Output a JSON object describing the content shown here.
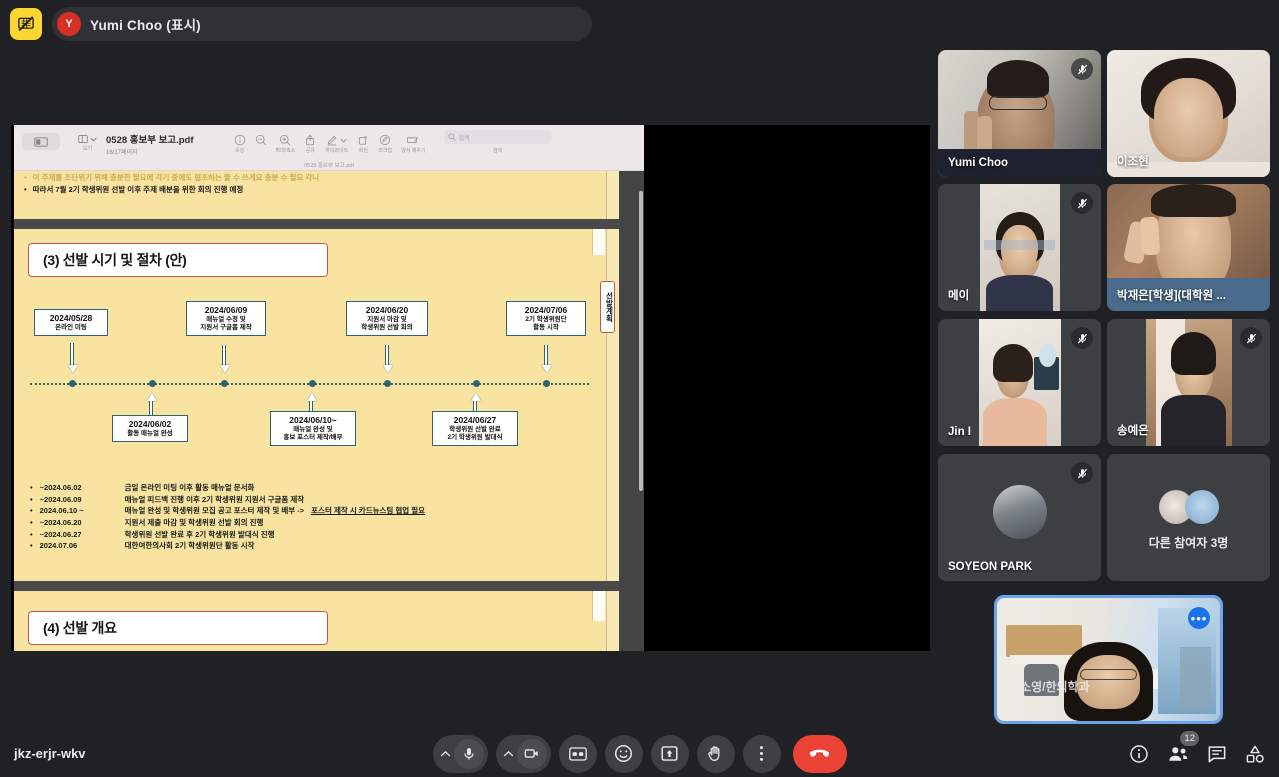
{
  "topbar": {
    "stop_present_icon": "stop-presenting-icon",
    "presenter_initial": "Y",
    "presenter_label": "Yumi Choo (표시)"
  },
  "preview_window": {
    "sidebar_button_icon": "sidebar-toggle-icon",
    "view_label": "보기",
    "doc_name": "0528 홍보부 보고.pdf",
    "doc_pages": "16/17페이지",
    "window_title": "0528 홍보부 보고.pdf",
    "tools": [
      {
        "icon": "info-icon",
        "label": "속성"
      },
      {
        "icon": "zoom-out-icon",
        "label": ""
      },
      {
        "icon": "zoom-in-icon",
        "label": "확대/축소"
      },
      {
        "icon": "share-icon",
        "label": "공유"
      },
      {
        "icon": "highlight-pen-icon",
        "label": "하이라이트"
      },
      {
        "icon": "rotate-icon",
        "label": "회전"
      },
      {
        "icon": "markup-icon",
        "label": "마크업"
      },
      {
        "icon": "form-fill-icon",
        "label": "양식 채우기"
      }
    ],
    "search_placeholder": "검색",
    "search_label": "검색"
  },
  "slide": {
    "prev_bullets": [
      "이 주제를 조단위기 위해 충분한 필요에 각기 중에도 협조하는 줄 수 쓰게요 충분 수 필요 각니",
      "따라서 7월 2기 학생위원 선발 이후 주제 배분을 위한 회의 진행 예정"
    ],
    "section_title": "(3) 선발 시기 및 절차 (안)",
    "next_section_title": "(4) 선발 개요",
    "side_tab": "선발계획",
    "side_tab_partial": "선",
    "timeline_top": [
      {
        "date": "2024/05/28",
        "lines": [
          "온라인 미팅"
        ]
      },
      {
        "date": "2024/06/09",
        "lines": [
          "매뉴얼 수정 및",
          "지원서 구글폼 제작"
        ]
      },
      {
        "date": "2024/06/20",
        "lines": [
          "지원서 마감 및",
          "학생위원 선발 회의"
        ]
      },
      {
        "date": "2024/07/06",
        "lines": [
          "2기 학생위원단",
          "활동 시작"
        ]
      }
    ],
    "timeline_bottom": [
      {
        "date": "2024/06/02",
        "lines": [
          "활동 매뉴얼 완성"
        ]
      },
      {
        "date": "2024/06/10~",
        "lines": [
          "매뉴얼 완성 및",
          "홍보 포스터 제작/배부"
        ]
      },
      {
        "date": "2024/06/27",
        "lines": [
          "학생위원 선발 완료",
          "2기 학생위원 발대식"
        ]
      }
    ],
    "bullets": [
      {
        "date": "~2024.06.02",
        "text": "금일 온라인 미팅 이후 활동 매뉴얼 문서화",
        "underline": ""
      },
      {
        "date": "~2024.06.09",
        "text": "매뉴얼 피드백 진행 이후 2기 학생위원 지원서 구글폼 제작",
        "underline": ""
      },
      {
        "date": "2024.06.10 ~",
        "text": "매뉴얼 완성 및 학생위원 모집 공고 포스터 제작 및 배부 -> ",
        "underline": "포스터 제작 시 카드뉴스팀 협업 필요"
      },
      {
        "date": "~2024.06.20",
        "text": "지원서 제출 마감 및 학생위원 선발 회의 진행",
        "underline": ""
      },
      {
        "date": "~2024.06.27",
        "text": "학생위원 선발 완료 후 2기 학생위원 발대식 진행",
        "underline": ""
      },
      {
        "date": "2024.07.06",
        "text": "대한여한의사회 2기 학생위원단 활동 시작",
        "underline": ""
      }
    ]
  },
  "participants": [
    {
      "name": "Yumi Choo",
      "muted": true,
      "kind": "video-wide"
    },
    {
      "name": "이조현",
      "muted": false,
      "kind": "video-wide"
    },
    {
      "name": "메이",
      "muted": true,
      "kind": "video-portrait"
    },
    {
      "name": "박재은[학생](대학원 ...",
      "muted": false,
      "kind": "video-wide"
    },
    {
      "name": "Jin I",
      "muted": true,
      "kind": "video-portrait"
    },
    {
      "name": "송예은",
      "muted": true,
      "kind": "video-portrait"
    },
    {
      "name": "SOYEON PARK",
      "muted": true,
      "kind": "avatar"
    },
    {
      "name": "다른 참여자 3명",
      "muted": false,
      "kind": "others"
    }
  ],
  "selfview": {
    "name": "인소영/한의학과",
    "more_icon": "more-options-icon"
  },
  "bottombar": {
    "meeting_code": "jkz-erjr-wkv",
    "controls": [
      {
        "name": "microphone-button",
        "icon": "mic-icon"
      },
      {
        "name": "camera-button",
        "icon": "video-camera-icon"
      },
      {
        "name": "captions-button",
        "icon": "closed-captions-icon"
      },
      {
        "name": "emoji-button",
        "icon": "emoji-smiley-icon"
      },
      {
        "name": "present-button",
        "icon": "present-screen-icon"
      },
      {
        "name": "raise-hand-button",
        "icon": "raised-hand-icon"
      },
      {
        "name": "more-options-button",
        "icon": "three-dots-vertical-icon"
      },
      {
        "name": "end-call-button",
        "icon": "phone-hangup-icon"
      }
    ],
    "right_icons": [
      {
        "name": "meeting-details-button",
        "icon": "info-circle-icon",
        "badge": ""
      },
      {
        "name": "people-button",
        "icon": "people-icon",
        "badge": "12"
      },
      {
        "name": "chat-button",
        "icon": "chat-bubble-icon",
        "badge": ""
      },
      {
        "name": "activities-button",
        "icon": "activities-icon",
        "badge": ""
      }
    ]
  },
  "colors": {
    "app_bg": "#202124",
    "accent_yellow": "#fdd633",
    "end_call_red": "#ea4335",
    "self_border_blue": "#6ba4e8",
    "slide_bg": "#f8e3a0",
    "slide_accent": "#c0564a",
    "timeline_teal": "#2c6472"
  }
}
